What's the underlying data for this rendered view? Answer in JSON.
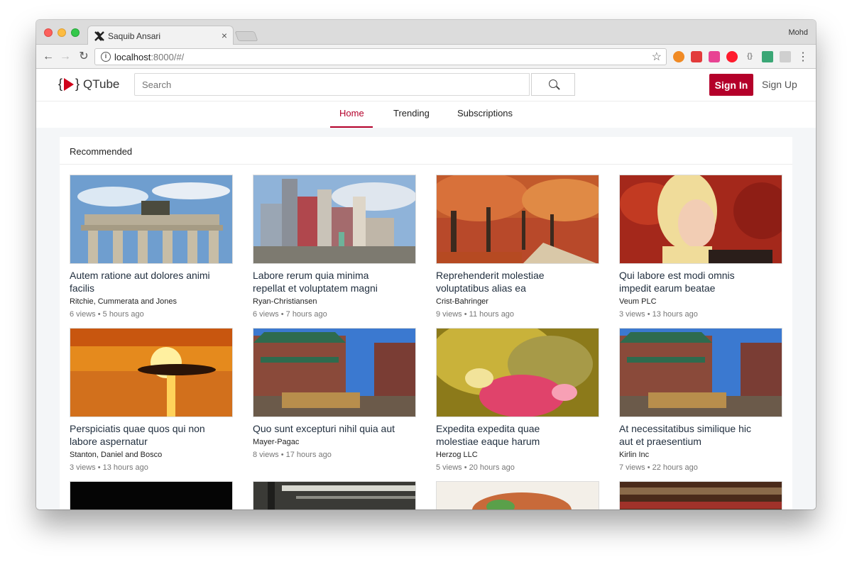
{
  "browser": {
    "tab_title": "Saquib Ansari",
    "tab_close": "×",
    "profile_name": "Mohd",
    "url_host": "localhost",
    "url_rest": ":8000/#/",
    "star_glyph": "☆",
    "menu_glyph": "⋮",
    "back_glyph": "←",
    "forward_glyph": "→",
    "reload_glyph": "↻",
    "info_glyph": "i"
  },
  "app": {
    "logo_open": "{",
    "logo_close": "}",
    "logo_name": "QTube",
    "search_placeholder": "Search",
    "signin_label": "Sign In",
    "signup_label": "Sign Up",
    "accent": "#b4002a"
  },
  "nav": {
    "tabs": [
      {
        "label": "Home",
        "active": true
      },
      {
        "label": "Trending",
        "active": false
      },
      {
        "label": "Subscriptions",
        "active": false
      }
    ]
  },
  "section": {
    "title": "Recommended"
  },
  "videos": [
    {
      "title": "Autem ratione aut dolores animi facilis",
      "channel": "Ritchie, Cummerata and Jones",
      "meta": "6 views • 5 hours ago",
      "thumb": "monument"
    },
    {
      "title": "Labore rerum quia minima repellat et voluptatem magni",
      "channel": "Ryan-Christiansen",
      "meta": "6 views • 7 hours ago",
      "thumb": "skyline"
    },
    {
      "title": "Reprehenderit molestiae voluptatibus alias ea",
      "channel": "Crist-Bahringer",
      "meta": "9 views • 11 hours ago",
      "thumb": "autumn"
    },
    {
      "title": "Qui labore est modi omnis impedit earum beatae",
      "channel": "Veum PLC",
      "meta": "3 views • 13 hours ago",
      "thumb": "portrait"
    },
    {
      "title": "Perspiciatis quae quos qui non labore aspernatur",
      "channel": "Stanton, Daniel and Bosco",
      "meta": "3 views • 13 hours ago",
      "thumb": "sunset"
    },
    {
      "title": "Quo sunt excepturi nihil quia aut",
      "channel": "Mayer-Pagac",
      "meta": "8 views • 17 hours ago",
      "thumb": "chinatown"
    },
    {
      "title": "Expedita expedita quae molestiae eaque harum",
      "channel": "Herzog LLC",
      "meta": "5 views • 20 hours ago",
      "thumb": "bubbles"
    },
    {
      "title": "At necessitatibus similique hic aut et praesentium",
      "channel": "Kirlin Inc",
      "meta": "7 views • 22 hours ago",
      "thumb": "chinatown"
    }
  ]
}
